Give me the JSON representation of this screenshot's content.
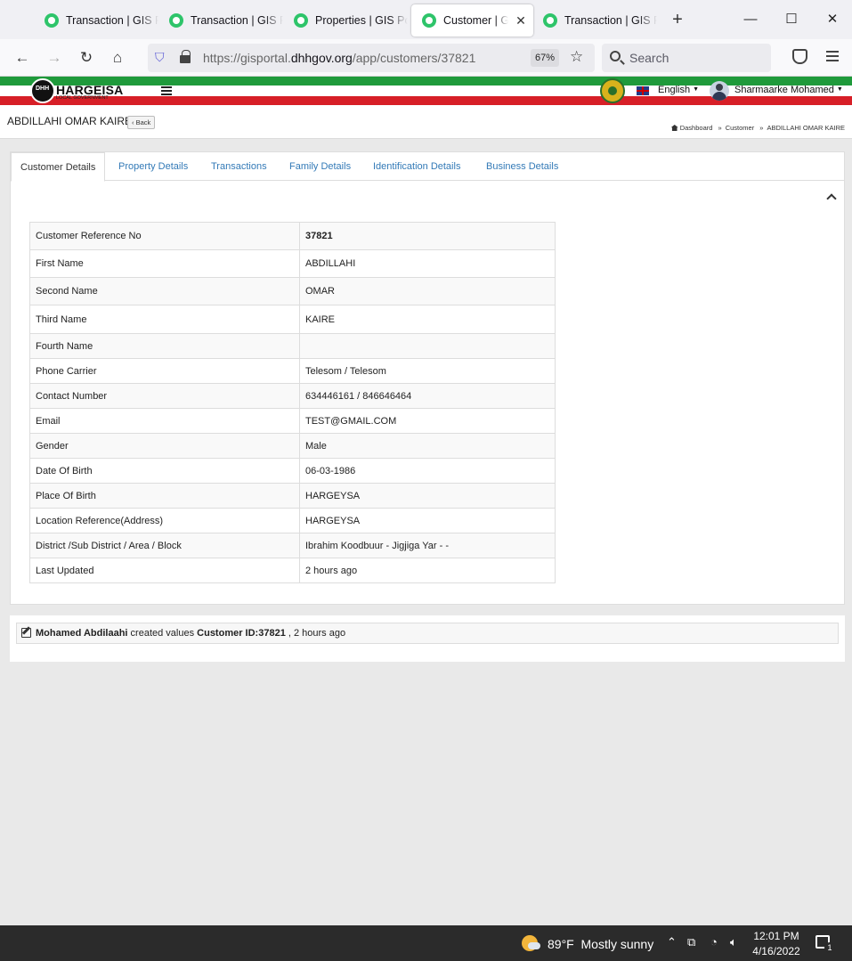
{
  "browser": {
    "tabs": [
      {
        "title": "Transaction | GIS Portal"
      },
      {
        "title": "Transaction | GIS Portal"
      },
      {
        "title": "Properties | GIS Portal"
      },
      {
        "title": "Customer | GIS Portal"
      },
      {
        "title": "Transaction | GIS Portal"
      }
    ],
    "url_prefix": "https://gisportal.",
    "url_domain": "dhhgov.org",
    "url_path": "/app/customers/37821",
    "zoom": "67%",
    "search_placeholder": "Search"
  },
  "app": {
    "logo_text": "HARGEISA",
    "logo_sub": "LOCAL GOVERNMENT",
    "logo_mark": "DHH",
    "language": "English",
    "user_name": "Sharmaarke Mohamed"
  },
  "page": {
    "title": "ABDILLAHI OMAR KAIRE",
    "back_label": "Back",
    "breadcrumb": [
      "Dashboard",
      "Customer",
      "ABDILLAHI OMAR KAIRE"
    ]
  },
  "tabs": [
    "Customer Details",
    "Property Details",
    "Transactions",
    "Family Details",
    "Identification Details",
    "Business Details"
  ],
  "details": [
    {
      "label": "Customer Reference No",
      "value": "37821"
    },
    {
      "label": "First Name",
      "value": "ABDILLAHI"
    },
    {
      "label": "Second Name",
      "value": "OMAR"
    },
    {
      "label": "Third Name",
      "value": "KAIRE"
    },
    {
      "label": "Fourth Name",
      "value": ""
    },
    {
      "label": "Phone Carrier",
      "value": "Telesom / Telesom"
    },
    {
      "label": "Contact Number",
      "value": "634446161 / 846646464"
    },
    {
      "label": "Email",
      "value": "TEST@GMAIL.COM"
    },
    {
      "label": "Gender",
      "value": "Male"
    },
    {
      "label": "Date Of Birth",
      "value": "06-03-1986"
    },
    {
      "label": "Place Of Birth",
      "value": "HARGEYSA"
    },
    {
      "label": "Location Reference(Address)",
      "value": "HARGEYSA"
    },
    {
      "label": "District /Sub District / Area / Block",
      "value": "Ibrahim Koodbuur - Jigjiga Yar - -"
    },
    {
      "label": "Last Updated",
      "value": "2 hours ago"
    }
  ],
  "activity": {
    "user": "Mohamed Abdilaahi",
    "action": " created values ",
    "target": "Customer ID:37821",
    "time": " , 2 hours ago"
  },
  "taskbar": {
    "temperature": "89°F",
    "condition": "Mostly sunny",
    "time": "12:01 PM",
    "date": "4/16/2022",
    "notification_count": "1"
  }
}
